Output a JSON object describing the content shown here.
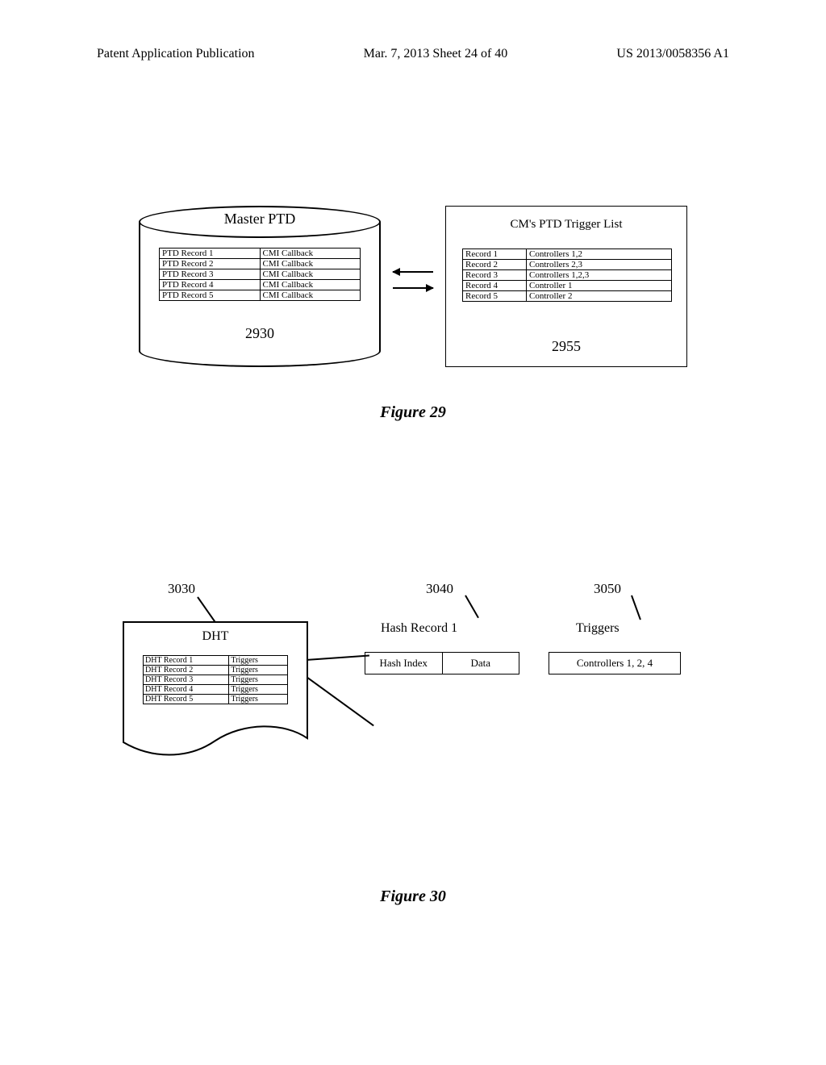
{
  "header": {
    "left": "Patent Application Publication",
    "mid": "Mar. 7, 2013  Sheet 24 of 40",
    "right": "US 2013/0058356 A1"
  },
  "fig29": {
    "caption": "Figure 29",
    "master": {
      "title": "Master PTD",
      "ref": "2930",
      "rows": [
        {
          "l": "PTD Record 1",
          "r": "CMI Callback"
        },
        {
          "l": "PTD Record 2",
          "r": "CMI Callback"
        },
        {
          "l": "PTD Record 3",
          "r": "CMI Callback"
        },
        {
          "l": "PTD Record 4",
          "r": "CMI Callback"
        },
        {
          "l": "PTD Record 5",
          "r": "CMI Callback"
        }
      ]
    },
    "trigger": {
      "title": "CM's PTD Trigger List",
      "ref": "2955",
      "rows": [
        {
          "l": "Record 1",
          "r": "Controllers 1,2"
        },
        {
          "l": "Record 2",
          "r": "Controllers 2,3"
        },
        {
          "l": "Record 3",
          "r": "Controllers 1,2,3"
        },
        {
          "l": "Record 4",
          "r": "Controller 1"
        },
        {
          "l": "Record 5",
          "r": "Controller 2"
        }
      ]
    }
  },
  "fig30": {
    "caption": "Figure 30",
    "dht": {
      "ref": "3030",
      "title": "DHT",
      "rows": [
        {
          "l": "DHT Record 1",
          "r": "Triggers"
        },
        {
          "l": "DHT Record 2",
          "r": "Triggers"
        },
        {
          "l": "DHT Record 3",
          "r": "Triggers"
        },
        {
          "l": "DHT Record 4",
          "r": "Triggers"
        },
        {
          "l": "DHT Record 5",
          "r": "Triggers"
        }
      ]
    },
    "hash": {
      "ref": "3040",
      "title": "Hash Record 1",
      "c1": "Hash Index",
      "c2": "Data"
    },
    "trig": {
      "ref": "3050",
      "title": "Triggers",
      "value": "Controllers 1, 2, 4"
    }
  }
}
